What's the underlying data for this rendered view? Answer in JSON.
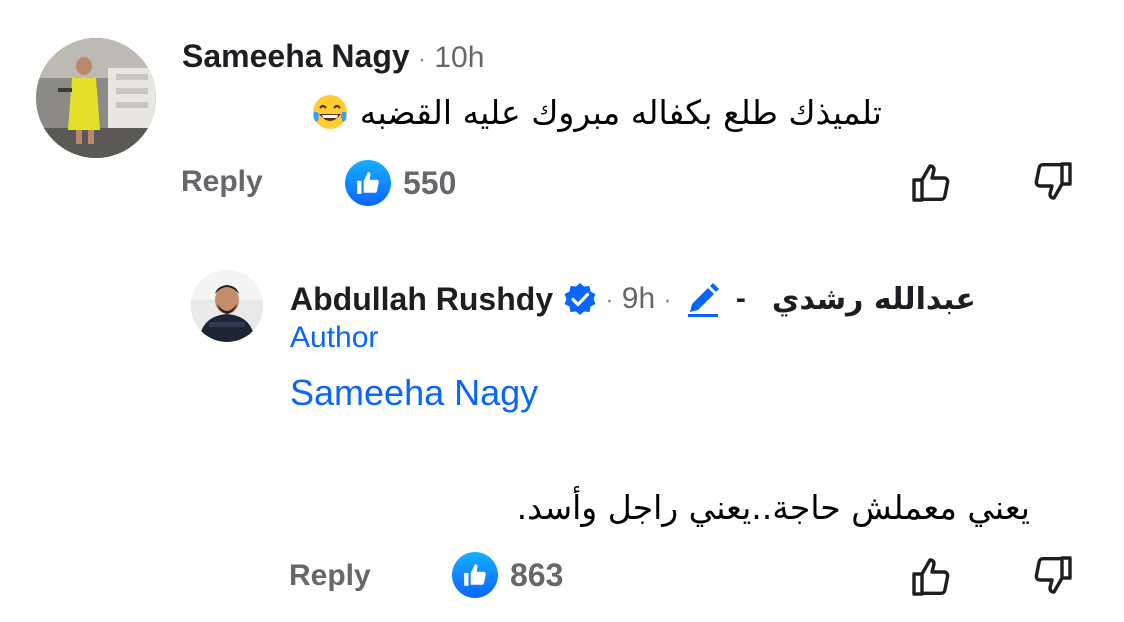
{
  "comments": [
    {
      "author": "Sameeha Nagy",
      "time": "10h",
      "text": "تلميذك طلع بكفاله مبروك عليه القضبه",
      "emoji": "laughing-tears",
      "reply_label": "Reply",
      "likes": "550"
    }
  ],
  "reply": {
    "author": "Abdullah Rushdy",
    "time": "9h",
    "name_separator": "-",
    "arabic_name": "عبدالله  رشدي",
    "badge": "Author",
    "mention": "Sameeha Nagy",
    "text": "يعني معملش حاجة..يعني راجل وأسد.",
    "reply_label": "Reply",
    "likes": "863"
  },
  "ui": {
    "dot": "·",
    "icons": [
      "like-reaction-icon",
      "thumbs-up-icon",
      "thumbs-down-icon",
      "verified-badge-icon",
      "edited-pencil-icon"
    ],
    "colors": {
      "accent": "#0866ff",
      "muted": "#65676b",
      "text": "#1c1e21"
    }
  }
}
